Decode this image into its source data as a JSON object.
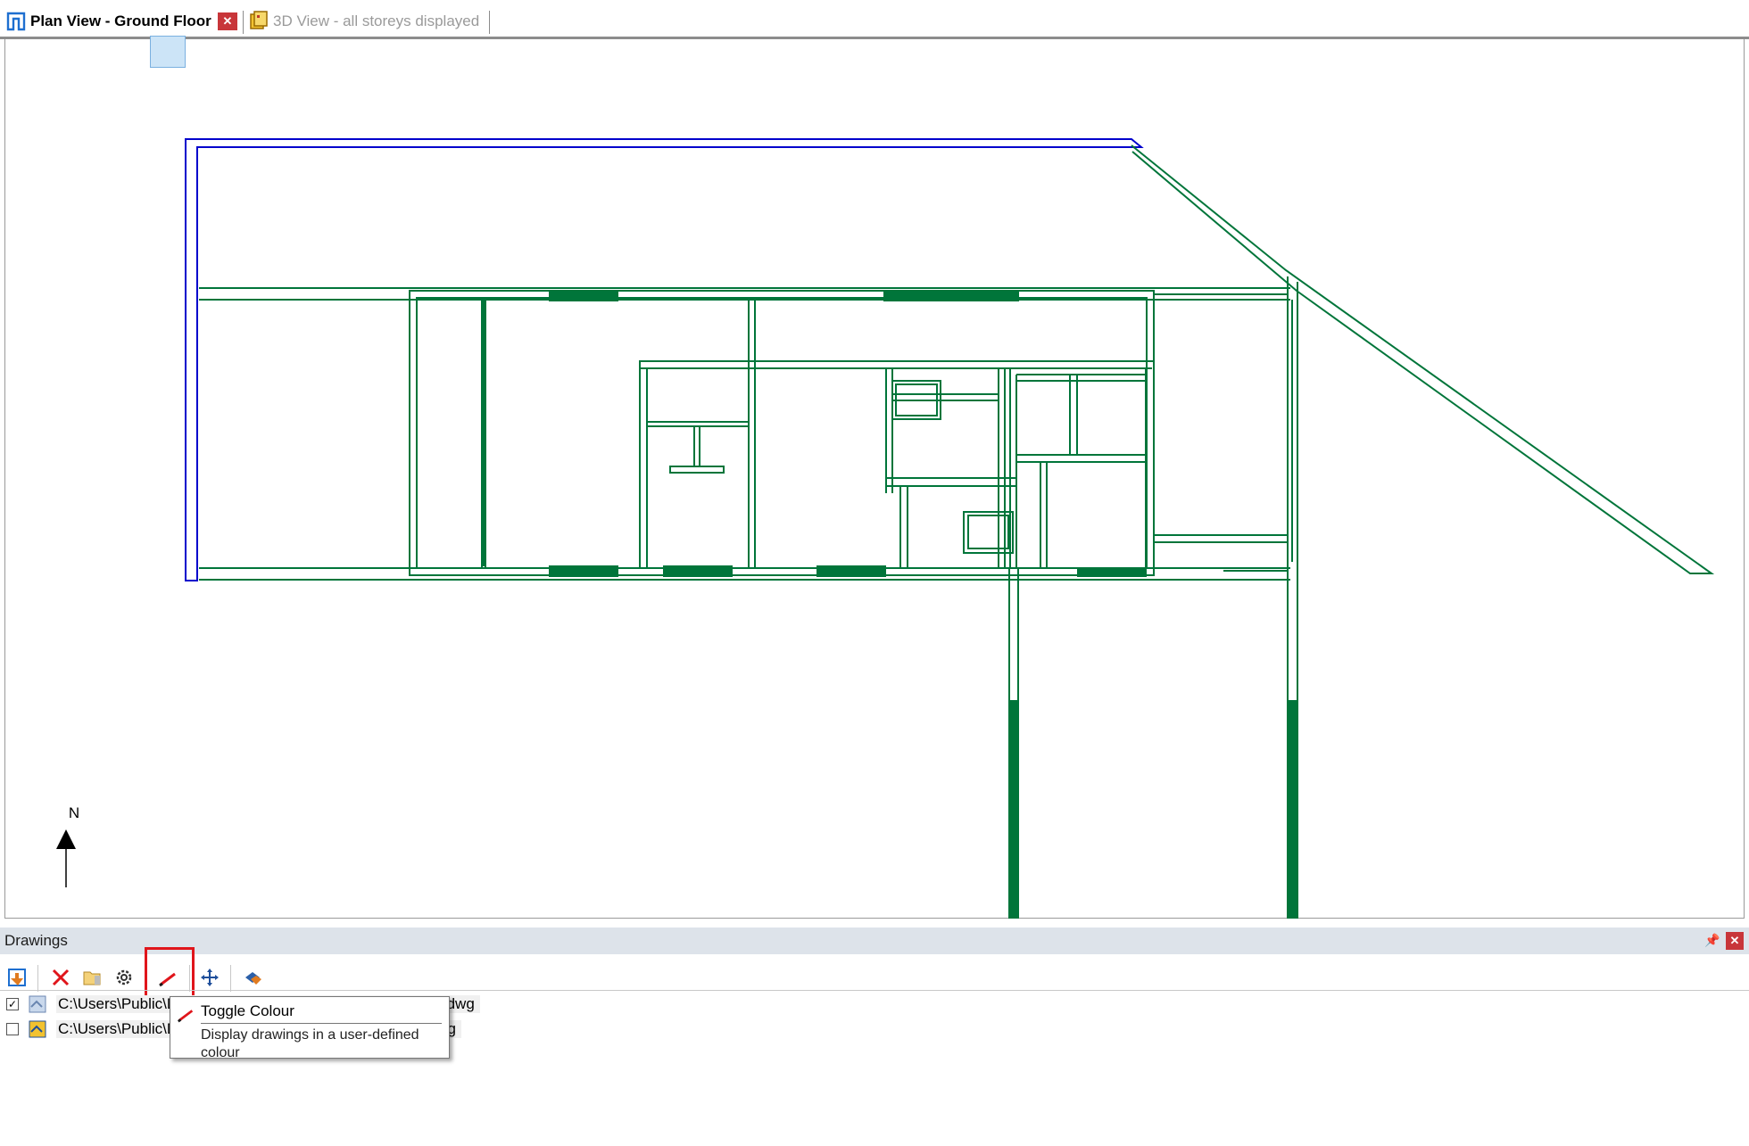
{
  "tabs": [
    {
      "label": "Plan View - Ground Floor",
      "active": true
    },
    {
      "label": "3D View - all storeys displayed",
      "active": false
    }
  ],
  "canvas": {
    "north_label": "N",
    "wall_colour": "#00753a",
    "boundary_colour": "#0000cc"
  },
  "panel": {
    "title": "Drawings",
    "toolbar": [
      {
        "icon": "import-drawing-icon"
      },
      {
        "icon": "delete-icon"
      },
      {
        "icon": "open-folder-icon"
      },
      {
        "icon": "settings-gear-icon"
      },
      {
        "icon": "toggle-colour-icon",
        "active": true
      },
      {
        "icon": "move-icon"
      },
      {
        "icon": "layers-icon"
      }
    ],
    "items": [
      {
        "checked": true,
        "path": "C:\\Users\\Public\\Documents\\...\\Data\\Building B Level One.dwg"
      },
      {
        "checked": false,
        "path": "C:\\Users\\Public\\Documents\\...\\Data\\Building B Ground.dwg"
      }
    ]
  },
  "tooltip": {
    "title": "Toggle Colour",
    "body": "Display drawings in a user-defined colour"
  },
  "colors": {
    "highlight": "#e0151b",
    "close_button": "#c8363a",
    "panel_header": "#dde3ea"
  }
}
